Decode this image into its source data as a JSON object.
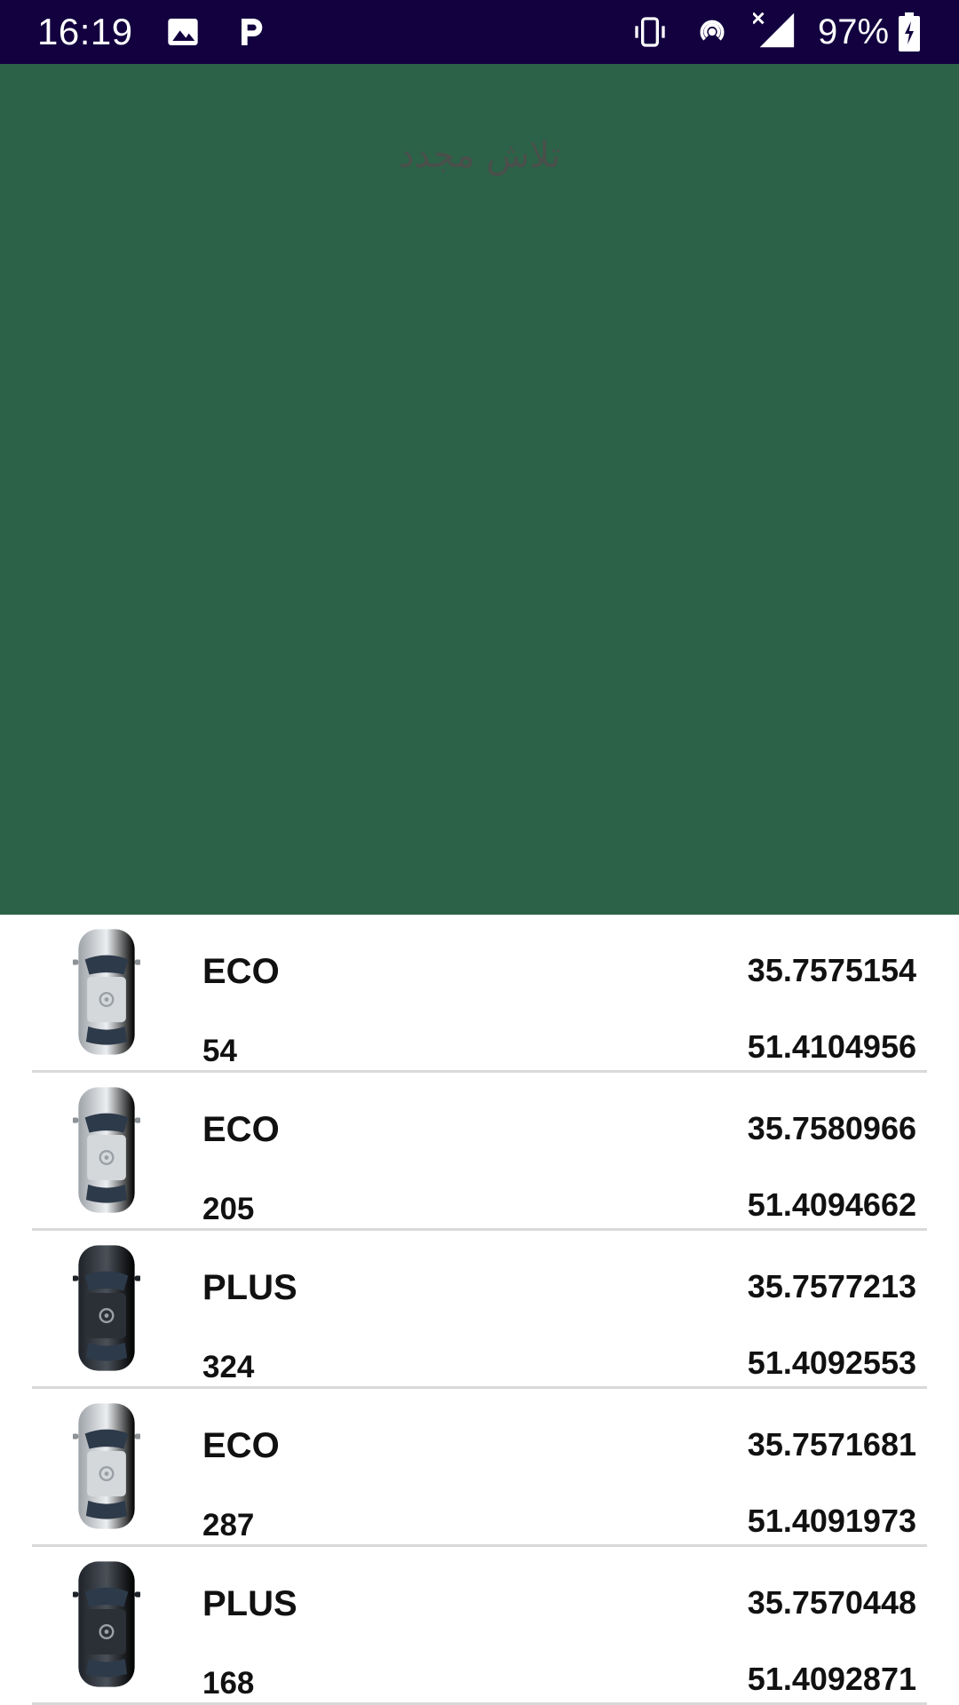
{
  "status_bar": {
    "time": "16:19",
    "battery": "97%",
    "icons": [
      "gallery-icon",
      "p-icon",
      "vibrate-icon",
      "hotspot-icon",
      "signal-icon",
      "battery-icon"
    ]
  },
  "map": {
    "retry_label": "تلاش مجدد",
    "background_color": "#2c6247"
  },
  "cars": [
    {
      "type": "ECO",
      "id": "54",
      "lat": "35.7575154",
      "lng": "51.4104956",
      "color": "light"
    },
    {
      "type": "ECO",
      "id": "205",
      "lat": "35.7580966",
      "lng": "51.4094662",
      "color": "light"
    },
    {
      "type": "PLUS",
      "id": "324",
      "lat": "35.7577213",
      "lng": "51.4092553",
      "color": "dark"
    },
    {
      "type": "ECO",
      "id": "287",
      "lat": "35.7571681",
      "lng": "51.4091973",
      "color": "light"
    },
    {
      "type": "PLUS",
      "id": "168",
      "lat": "35.7570448",
      "lng": "51.4092871",
      "color": "dark"
    }
  ]
}
